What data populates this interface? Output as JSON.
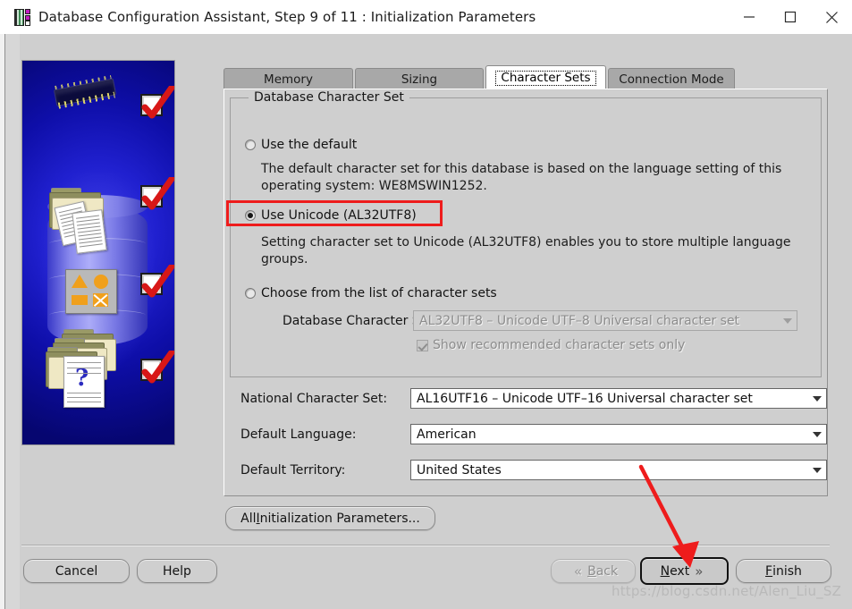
{
  "window": {
    "title": "Database Configuration Assistant, Step 9 of 11 : Initialization Parameters",
    "icon": "database-app-icon",
    "minimize_label": "—",
    "maximize_label": "☐",
    "close_label": "✕"
  },
  "tabs": [
    {
      "label": "Memory",
      "active": false
    },
    {
      "label": "Sizing",
      "active": false
    },
    {
      "label": "Character Sets",
      "active": true
    },
    {
      "label": "Connection Mode",
      "active": false
    }
  ],
  "group": {
    "title": "Database Character Set",
    "options": [
      {
        "id": "use-default",
        "label": "Use the default",
        "selected": false,
        "description_line1": "The default character set for this database is based on the language setting of this",
        "description_line2": "operating system: WE8MSWIN1252."
      },
      {
        "id": "use-unicode",
        "label": "Use Unicode (AL32UTF8)",
        "selected": true,
        "description_line1": "Setting character set to Unicode (AL32UTF8) enables you to store multiple language",
        "description_line2": "groups."
      },
      {
        "id": "choose-from-list",
        "label": "Choose from the list of character sets",
        "selected": false
      }
    ],
    "database_char_set": {
      "label": "Database Character Set:",
      "value": "AL32UTF8 – Unicode UTF–8 Universal character set",
      "disabled": true
    },
    "show_recommended": {
      "label": "Show recommended character sets only",
      "checked": true,
      "disabled": true
    }
  },
  "fields": [
    {
      "label": "National Character Set:",
      "value": "AL16UTF16 – Unicode UTF–16 Universal character set"
    },
    {
      "label": "Default Language:",
      "value": "American"
    },
    {
      "label": "Default Territory:",
      "value": "United States"
    }
  ],
  "buttons": {
    "all_params": {
      "text_before": "All ",
      "mnemonic": "I",
      "text_after": "nitialization Parameters..."
    },
    "cancel": {
      "text": "Cancel"
    },
    "help": {
      "text": "Help"
    },
    "back": {
      "text_before": "",
      "mnemonic": "B",
      "text_after": "ack",
      "disabled": true,
      "chevron": "«"
    },
    "next": {
      "text_before": "",
      "mnemonic": "N",
      "text_after": "ext",
      "focused": true,
      "chevron": "»"
    },
    "finish": {
      "text_before": "",
      "mnemonic": "F",
      "text_after": "inish"
    }
  },
  "annotations": {
    "highlight_target": "use-unicode-radio",
    "arrow_target": "next-button",
    "color": "#ee1c1c"
  },
  "watermark": "https://blog.csdn.net/Alen_Liu_SZ"
}
